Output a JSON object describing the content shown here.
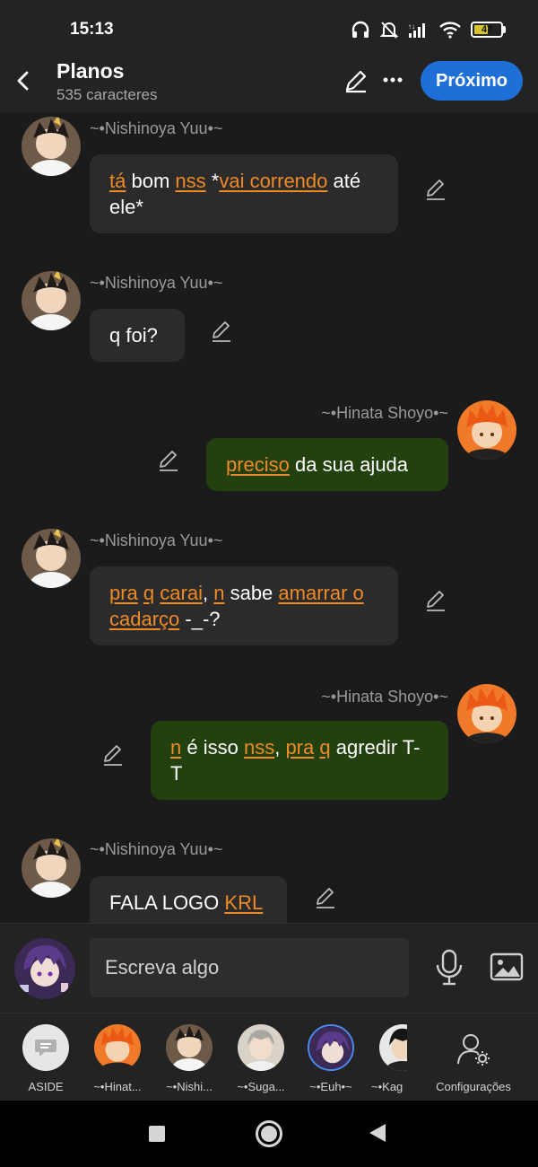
{
  "status_bar": {
    "time": "15:13",
    "battery": "47",
    "icons": [
      "headphones-icon",
      "mute-icon",
      "signal-icon",
      "wifi-icon",
      "battery-icon"
    ]
  },
  "header": {
    "title": "Planos",
    "subtitle": "535 caracteres",
    "next_label": "Próximo"
  },
  "messages": [
    {
      "side": "left",
      "name": "~•Nishinoya Yuu•~",
      "segments": [
        {
          "t": "tá",
          "hl": true
        },
        {
          "t": " bom "
        },
        {
          "t": "nss",
          "hl": true
        },
        {
          "t": " *"
        },
        {
          "t": "vai correndo",
          "hl": true
        },
        {
          "t": " até ele*"
        }
      ]
    },
    {
      "side": "left",
      "name": "~•Nishinoya Yuu•~",
      "segments": [
        {
          "t": "q foi?"
        }
      ]
    },
    {
      "side": "right",
      "name": "~•Hinata Shoyo•~",
      "segments": [
        {
          "t": "preciso",
          "hl": true
        },
        {
          "t": " da sua ajuda"
        }
      ]
    },
    {
      "side": "left",
      "name": "~•Nishinoya Yuu•~",
      "segments": [
        {
          "t": "pra",
          "hl": true
        },
        {
          "t": " "
        },
        {
          "t": "q",
          "hl": true
        },
        {
          "t": " "
        },
        {
          "t": "carai",
          "hl": true
        },
        {
          "t": ", "
        },
        {
          "t": "n",
          "hl": true
        },
        {
          "t": " sabe "
        },
        {
          "t": "amarrar o cadarço",
          "hl": true
        },
        {
          "t": " -_-?"
        }
      ]
    },
    {
      "side": "right",
      "name": "~•Hinata Shoyo•~",
      "segments": [
        {
          "t": "n",
          "hl": true
        },
        {
          "t": " é isso "
        },
        {
          "t": "nss",
          "hl": true
        },
        {
          "t": ", "
        },
        {
          "t": "pra",
          "hl": true
        },
        {
          "t": " "
        },
        {
          "t": "q",
          "hl": true
        },
        {
          "t": " agredir T-T"
        }
      ]
    },
    {
      "side": "left",
      "name": "~•Nishinoya Yuu•~",
      "segments": [
        {
          "t": "FALA LOGO "
        },
        {
          "t": "KRL",
          "hl": true
        }
      ]
    }
  ],
  "composer": {
    "placeholder": "Escreva algo"
  },
  "characters": [
    {
      "label": "ASIDE",
      "kind": "aside"
    },
    {
      "label": "~•Hinat...",
      "kind": "hinata"
    },
    {
      "label": "~•Nishi...",
      "kind": "nishinoya"
    },
    {
      "label": "~•Suga...",
      "kind": "suga"
    },
    {
      "label": "~•Euh•~",
      "kind": "euh"
    },
    {
      "label": "~•Kag",
      "kind": "kageyama"
    }
  ],
  "settings_label": "Configurações",
  "colors": {
    "highlight": "#f08a24",
    "left_bubble": "#2b2b2b",
    "right_bubble": "#22410f",
    "accent_button": "#1e6fd8"
  }
}
